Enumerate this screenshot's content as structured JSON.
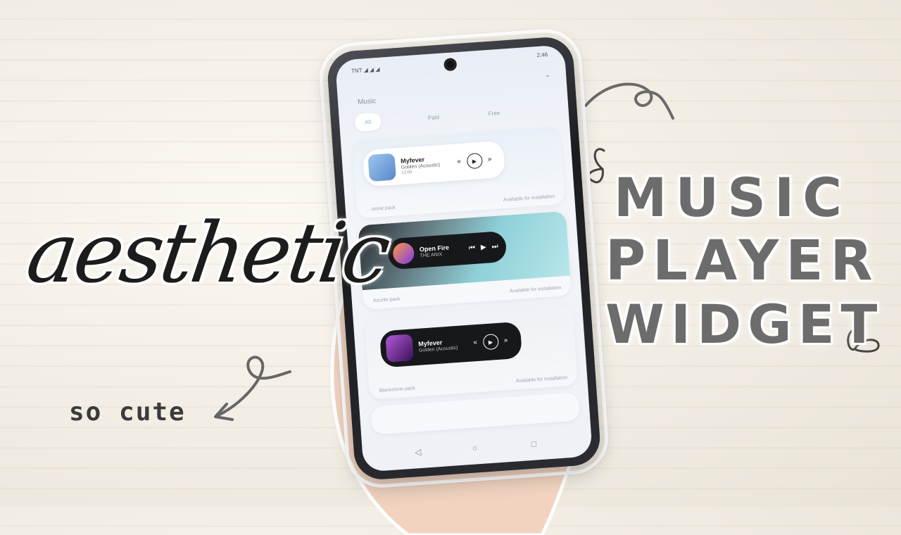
{
  "overlay": {
    "script_word": "aesthetic",
    "caption": "so cute",
    "title_lines": [
      "MUSIC",
      "PLAYER",
      "WIDGET"
    ]
  },
  "phone": {
    "status_left": "TNT ◢ ◢ ◢",
    "status_right": "2:46",
    "section_title": "Music",
    "tabs": [
      {
        "label": "All",
        "active": true
      },
      {
        "label": "Paid",
        "active": false
      },
      {
        "label": "Free",
        "active": false
      }
    ],
    "cards": [
      {
        "pack_name": "…stone pack",
        "availability": "Available for installation",
        "widget": {
          "title": "Myfever",
          "subtitle": "Golden (Acoustic)",
          "time": "12:09"
        }
      },
      {
        "pack_name": "Azurite pack",
        "availability": "Available for installation",
        "widget": {
          "title": "Open Fire",
          "subtitle": "THE ANIX"
        }
      },
      {
        "pack_name": "Blackstone pack",
        "availability": "Available for installation",
        "widget": {
          "title": "Myfever",
          "subtitle": "Golden (Acoustic)"
        }
      }
    ],
    "nav": {
      "back": "◁",
      "home": "○",
      "recents": "□"
    }
  },
  "colors": {
    "title_gray": "#6c6c6c",
    "accent_teal": "#7cc2d9",
    "widget_dark": "#17181c"
  }
}
